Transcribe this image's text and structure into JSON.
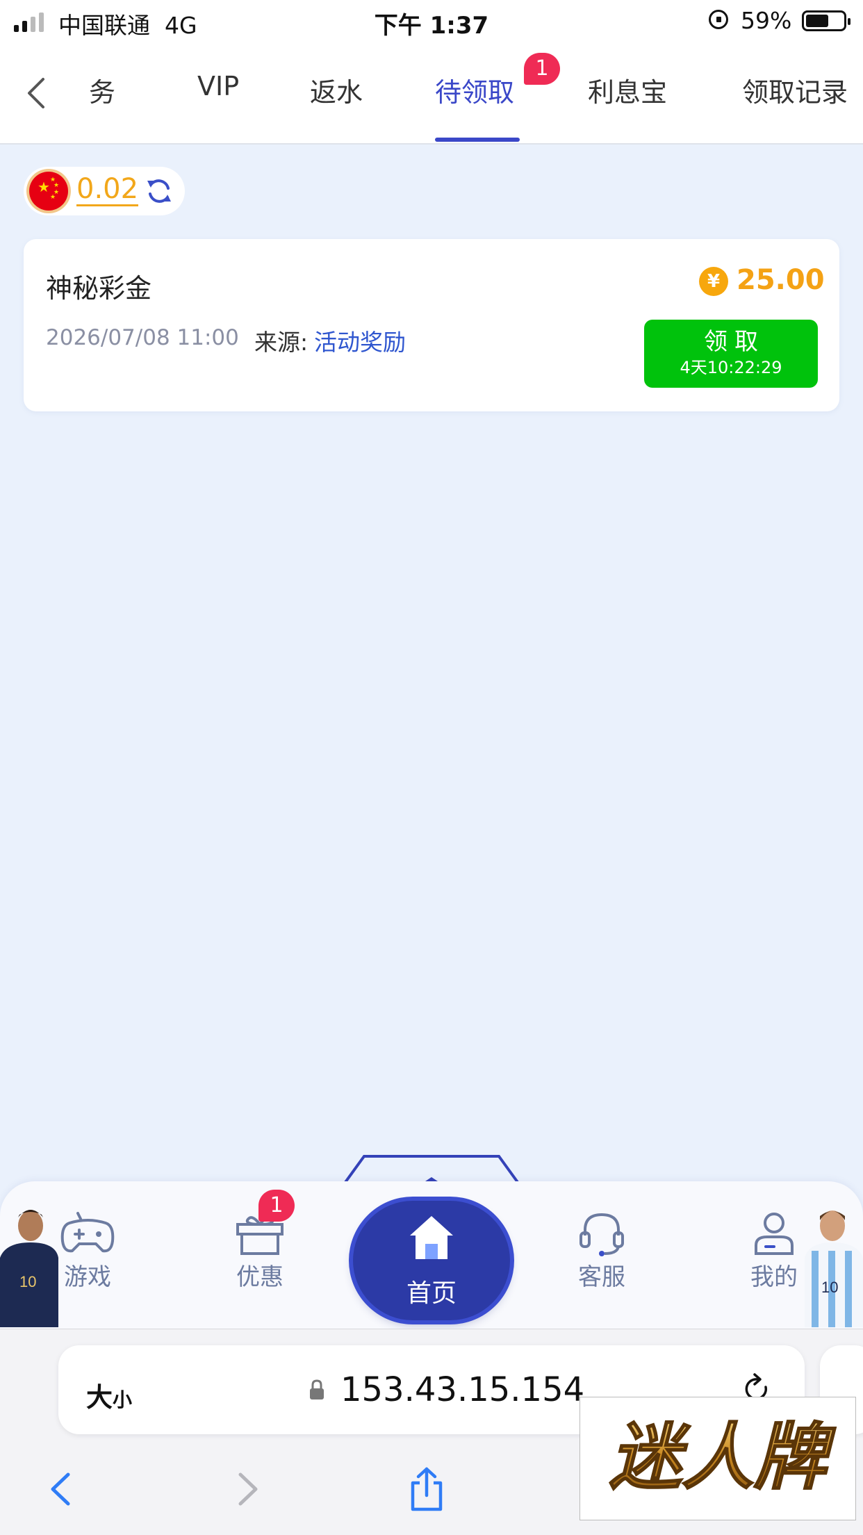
{
  "status_bar": {
    "carrier": "中国联通",
    "network": "4G",
    "time": "下午 1:37",
    "battery": "59%"
  },
  "header": {
    "tabs": [
      {
        "label": "务",
        "active": false
      },
      {
        "label": "VIP",
        "active": false
      },
      {
        "label": "返水",
        "active": false
      },
      {
        "label": "待领取",
        "active": true,
        "badge": "1"
      },
      {
        "label": "利息宝",
        "active": false
      },
      {
        "label": "领取记录",
        "active": false
      }
    ],
    "accent_color": "#3a47c8"
  },
  "balance": {
    "value": "0.02",
    "color": "#f2a71a"
  },
  "reward": {
    "title": "神秘彩金",
    "currency_symbol": "¥",
    "amount": "25.00",
    "date": "2026/07/08 11:00",
    "source_label": "来源:",
    "source_value": "活动奖励",
    "claim_label": "领取",
    "countdown": "4天10:22:29",
    "claim_color": "#00c20c"
  },
  "bottom_nav": {
    "items": [
      {
        "label": "游戏",
        "icon": "gamepad-icon"
      },
      {
        "label": "优惠",
        "icon": "gift-icon",
        "badge": "1"
      },
      {
        "label": "首页",
        "icon": "home-icon"
      },
      {
        "label": "客服",
        "icon": "headset-icon"
      },
      {
        "label": "我的",
        "icon": "user-icon"
      }
    ]
  },
  "browser": {
    "text_size_big": "大",
    "text_size_small": "小",
    "url": "153.43.15.154"
  },
  "watermark": {
    "text": "迷人牌"
  }
}
